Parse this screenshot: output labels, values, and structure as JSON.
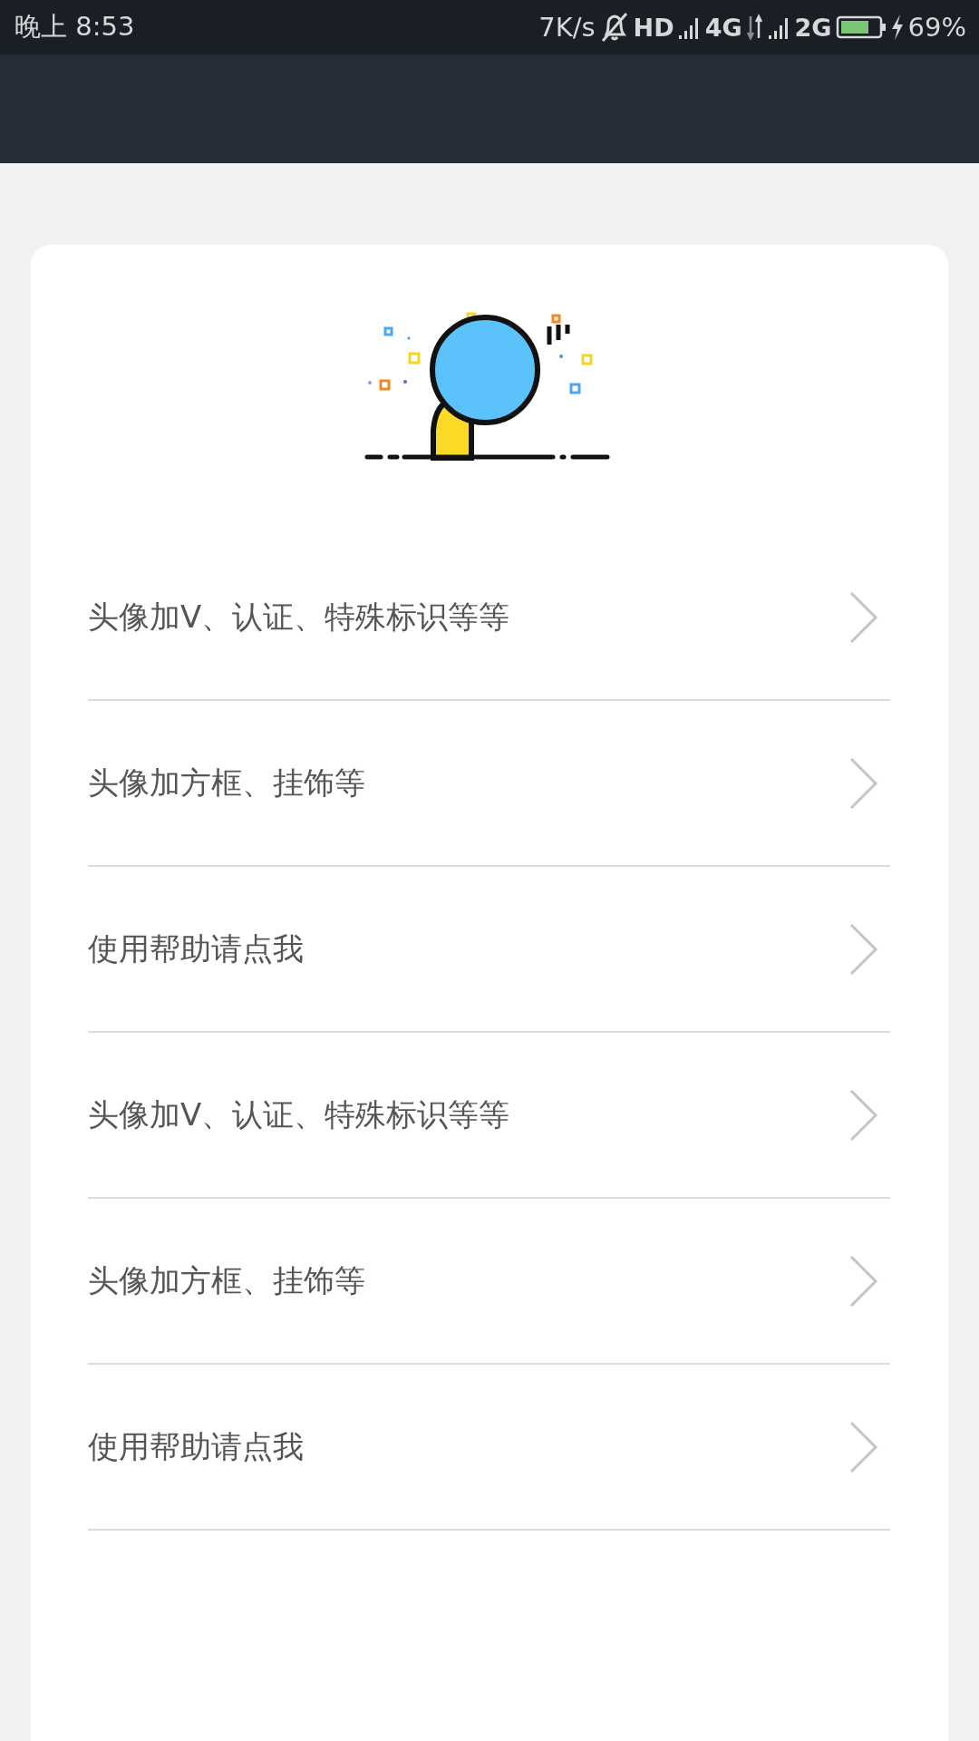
{
  "status_bar": {
    "time": "晚上 8:53",
    "speed": "7K/s",
    "hd": "HD",
    "network_1": "4G",
    "network_2": "2G",
    "battery": "69%"
  },
  "menu_items": [
    {
      "label": "头像加V、认证、特殊标识等等"
    },
    {
      "label": "头像加方框、挂饰等"
    },
    {
      "label": "使用帮助请点我"
    },
    {
      "label": "头像加V、认证、特殊标识等等"
    },
    {
      "label": "头像加方框、挂饰等"
    },
    {
      "label": "使用帮助请点我"
    }
  ]
}
